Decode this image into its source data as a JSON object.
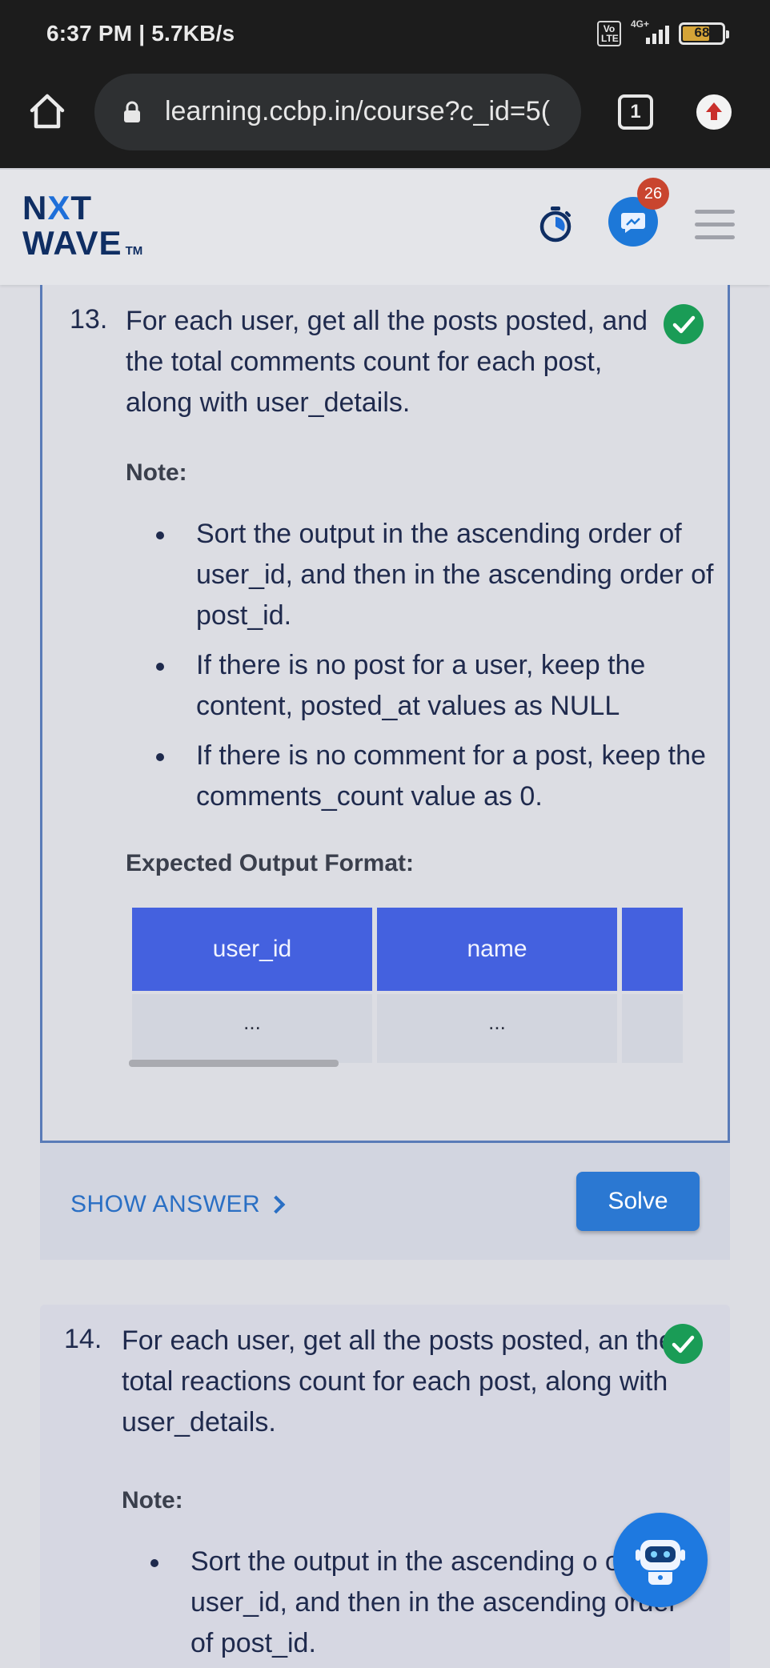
{
  "status_bar": {
    "time_speed": "6:37 PM | 5.7KB/s",
    "volte": "Vo LTE",
    "network": "4G+",
    "battery": "68"
  },
  "browser": {
    "url": "learning.ccbp.in/course?c_id=5(",
    "tab_count": "1"
  },
  "app_header": {
    "logo_line1_a": "N",
    "logo_line1_x": "X",
    "logo_line1_b": "T",
    "logo_line2": "WAVE",
    "logo_tm": "TM",
    "notification_count": "26"
  },
  "question13": {
    "number": "13.",
    "text": "For each user, get all the posts posted, and the total comments count for each post, along with user_details.",
    "note_label": "Note:",
    "notes": [
      "Sort the output in the ascending order of user_id, and then in the ascending order of post_id.",
      "If there is no post for a user, keep the content, posted_at values as NULL",
      "If there is no comment for a post, keep the comments_count value as 0."
    ],
    "expected_label": "Expected Output Format:",
    "table": {
      "headers": [
        "user_id",
        "name",
        ""
      ],
      "row": [
        "...",
        "...",
        ""
      ]
    }
  },
  "answer_bar": {
    "show_answer": "SHOW ANSWER",
    "solve": "Solve"
  },
  "question14": {
    "number": "14.",
    "text": "For each user, get all the posts posted, an the total reactions count for each post, along with user_details.",
    "note_label": "Note:",
    "notes": [
      "Sort the output in the ascending o of user_id, and then in the ascending order of post_id."
    ]
  },
  "colors": {
    "accent": "#4461df",
    "success": "#1a9c56",
    "link": "#2a6fc4",
    "button": "#2b78d2"
  }
}
